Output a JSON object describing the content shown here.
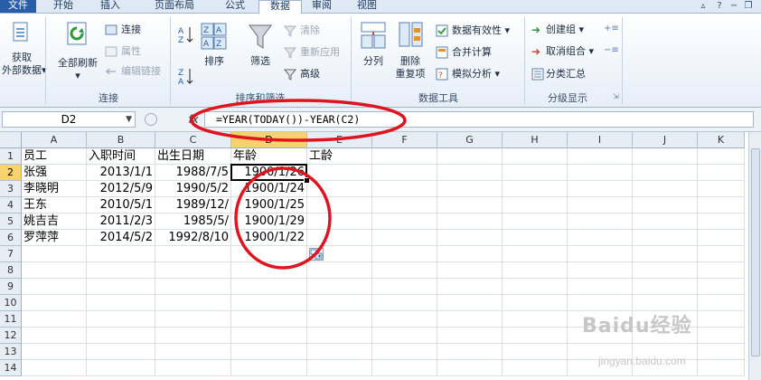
{
  "tabs": [
    "文件",
    "开始",
    "插入",
    "页面布局",
    "公式",
    "数据",
    "审阅",
    "视图"
  ],
  "active_tab": "数据",
  "ribbon": {
    "get_data": {
      "line1": "获取",
      "line2": "外部数据"
    },
    "refresh_all": "全部刷新",
    "connections": "连接",
    "properties": "属性",
    "edit_links": "编辑链接",
    "group_connections": "连接",
    "sort": "排序",
    "filter": "筛选",
    "clear": "清除",
    "reapply": "重新应用",
    "advanced": "高级",
    "group_sort_filter": "排序和筛选",
    "text_to_columns": "分列",
    "remove_duplicates": {
      "line1": "删除",
      "line2": "重复项"
    },
    "data_validation": "数据有效性",
    "consolidate": "合并计算",
    "what_if": "模拟分析",
    "group_data_tools": "数据工具",
    "group": "创建组",
    "ungroup": "取消组合",
    "subtotal": "分类汇总",
    "group_outline": "分级显示"
  },
  "formula_bar": {
    "name_box": "D2",
    "fx": "fx",
    "formula": "=YEAR(TODAY())-YEAR(C2)"
  },
  "columns": [
    "A",
    "B",
    "C",
    "D",
    "E",
    "F",
    "G",
    "H",
    "I",
    "J",
    "K"
  ],
  "selected_column": "D",
  "rows": [
    "1",
    "2",
    "3",
    "4",
    "5",
    "6",
    "7",
    "8",
    "9",
    "10",
    "11",
    "12",
    "13",
    "14"
  ],
  "selected_row": "2",
  "sheet": {
    "headers": [
      "员工",
      "入职时间",
      "出生日期",
      "年龄",
      "工龄"
    ],
    "data": [
      [
        "张强",
        "2013/1/1",
        "1988/7/5",
        "1900/1/26"
      ],
      [
        "李晓明",
        "2012/5/9",
        "1990/5/2",
        "1900/1/24"
      ],
      [
        "王东",
        "2010/5/1",
        "1989/12/",
        "1900/1/25"
      ],
      [
        "姚吉吉",
        "2011/2/3",
        "1985/5/",
        "1900/1/29"
      ],
      [
        "罗萍萍",
        "2014/5/2",
        "1992/8/10",
        "1900/1/22"
      ]
    ]
  },
  "watermark": {
    "brand": "Baidu经验",
    "url": "jingyan.baidu.com"
  },
  "colors": {
    "tab_file": "#2a5da8",
    "header_selected": "#f8d36d",
    "annotation_red": "#e0141e"
  },
  "icons": [
    "refresh-icon",
    "sort-az-icon",
    "sort-za-icon",
    "funnel-icon",
    "text-to-columns-icon",
    "remove-duplicates-icon"
  ]
}
